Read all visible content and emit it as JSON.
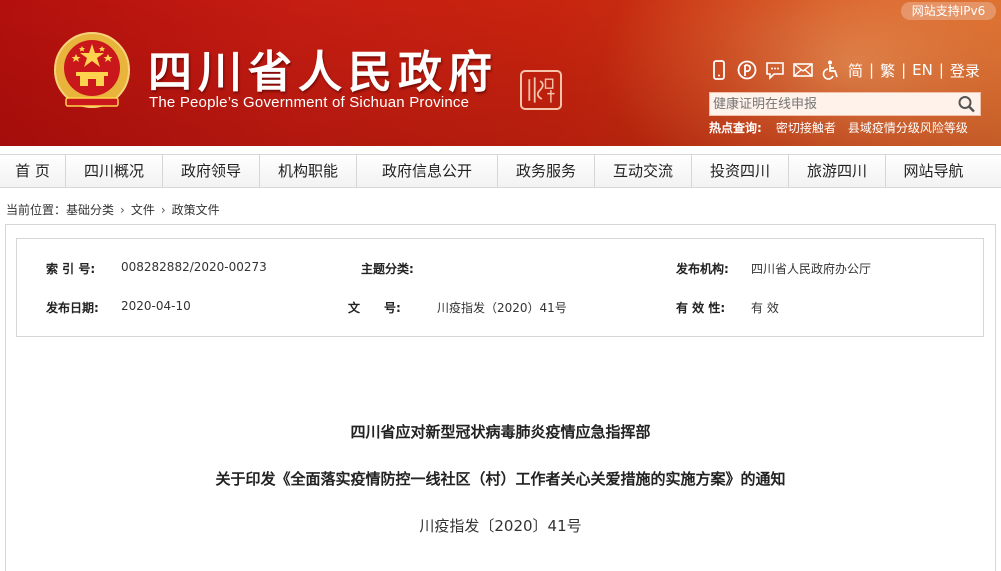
{
  "header": {
    "site_title": "四川省人民政府",
    "site_subtitle": "The People’s Government of Sichuan Province",
    "ipv6_badge": "网站支持IPv6",
    "lang": {
      "simplified": "简",
      "traditional": "繁",
      "english": "EN",
      "login": "登录",
      "separator": "|"
    },
    "search": {
      "placeholder": "健康证明在线申报",
      "value": ""
    },
    "hot": {
      "label": "热点查询:",
      "links": [
        "密切接触者",
        "县域疫情分级风险等级"
      ]
    },
    "icons": [
      "mobile-icon",
      "weibo-icon",
      "wechat-icon",
      "mail-icon",
      "accessibility-icon"
    ]
  },
  "nav": {
    "items": [
      "首 页",
      "四川概况",
      "政府领导",
      "机构职能",
      "政府信息公开",
      "政务服务",
      "互动交流",
      "投资四川",
      "旅游四川",
      "网站导航"
    ]
  },
  "breadcrumb": {
    "prefix": "当前位置：",
    "items": [
      "基础分类",
      "文件",
      "政策文件"
    ]
  },
  "meta": {
    "index_label": "索 引 号:",
    "index_value": "008282882/2020-00273",
    "topic_label": "主题分类:",
    "topic_value": "",
    "issuer_label": "发布机构:",
    "issuer_value": "四川省人民政府办公厅",
    "date_label": "发布日期:",
    "date_value": "2020-04-10",
    "docno_label": "文　　号:",
    "docno_value": "川疫指发（2020）41号",
    "validity_label": "有 效 性:",
    "validity_value": "有 效"
  },
  "document": {
    "issuer_line": "四川省应对新型冠状病毒肺炎疫情应急指挥部",
    "title": "关于印发《全面落实疫情防控一线社区（村）工作者关心关爱措施的实施方案》的通知",
    "doc_number": "川疫指发〔2020〕41号"
  },
  "colors": {
    "banner_red": "#c51d12",
    "banner_orange": "#d76a2a"
  }
}
